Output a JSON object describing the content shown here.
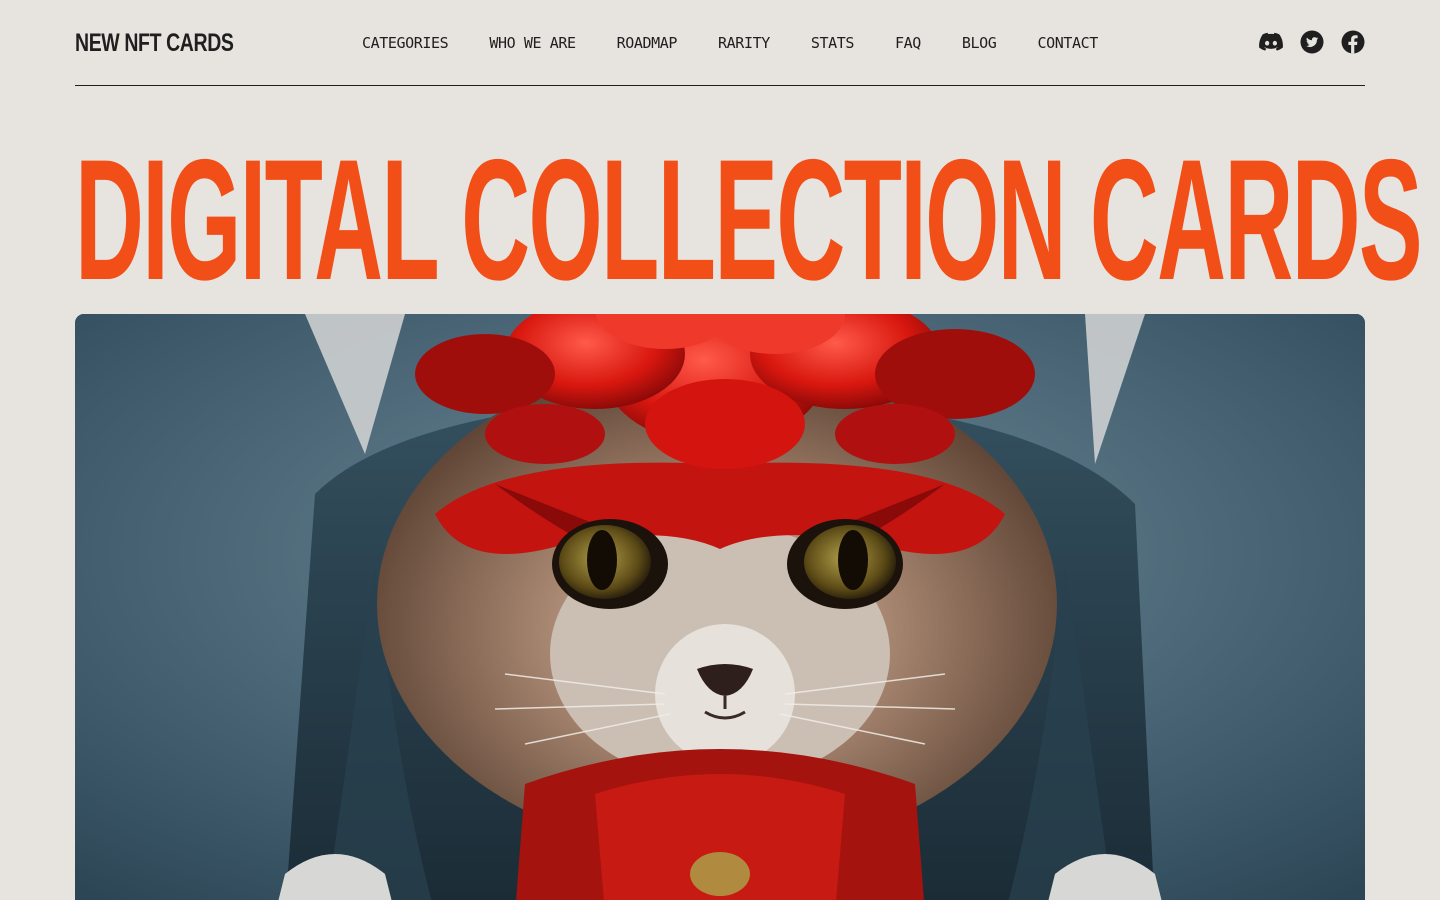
{
  "header": {
    "logo": "NEW NFT CARDS",
    "nav": [
      {
        "label": "CATEGORIES"
      },
      {
        "label": "WHO WE ARE"
      },
      {
        "label": "ROADMAP"
      },
      {
        "label": "RARITY"
      },
      {
        "label": "STATS"
      },
      {
        "label": "FAQ"
      },
      {
        "label": "BLOG"
      },
      {
        "label": "CONTACT"
      }
    ],
    "socials": [
      {
        "icon": "discord-icon"
      },
      {
        "icon": "twitter-icon"
      },
      {
        "icon": "facebook-icon"
      }
    ]
  },
  "hero": {
    "title": "DIGITAL COLLECTION CARDS"
  },
  "colors": {
    "background": "#e7e3de",
    "text": "#1f1f1f",
    "accent": "#f24e17"
  }
}
